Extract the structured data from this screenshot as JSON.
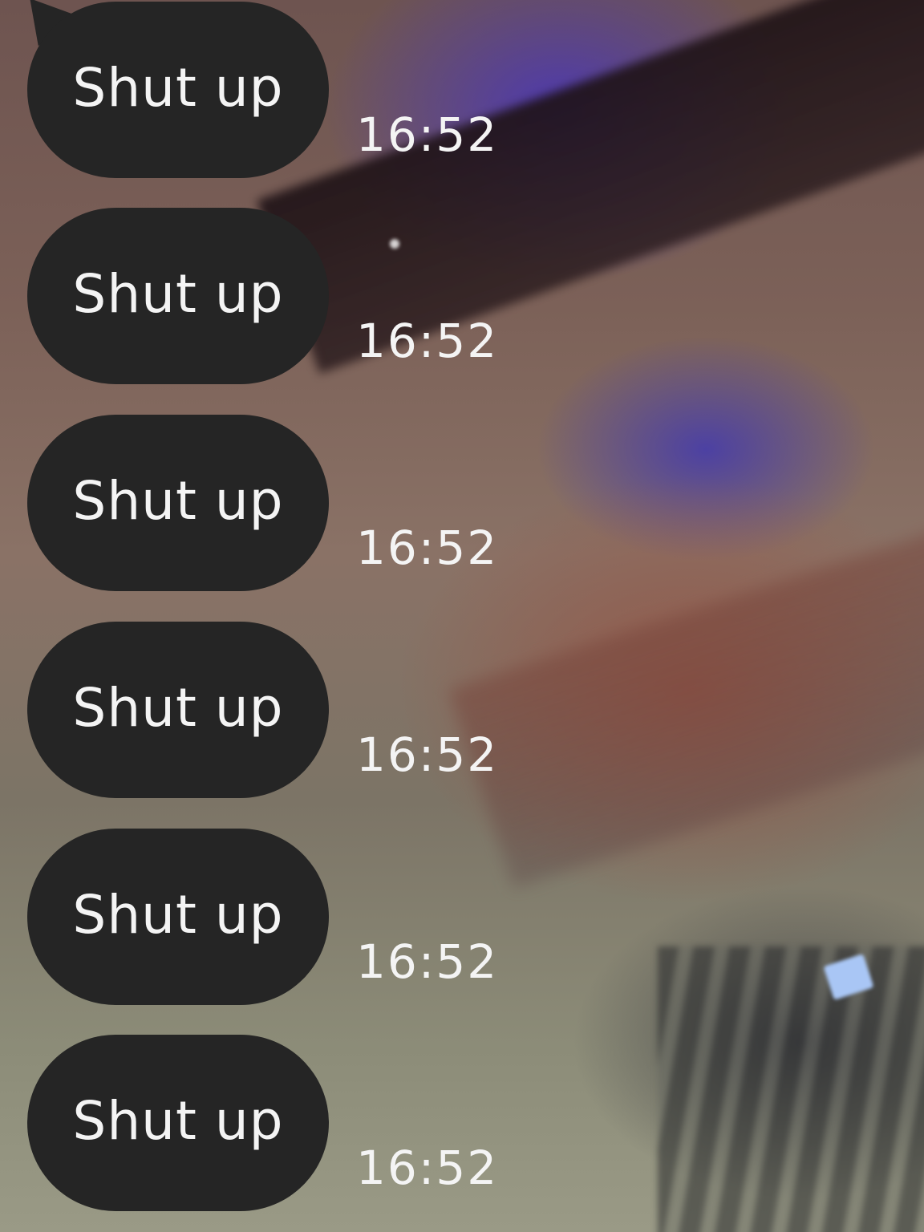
{
  "messages": [
    {
      "text": "Shut up",
      "time": "16:52"
    },
    {
      "text": "Shut up",
      "time": "16:52"
    },
    {
      "text": "Shut up",
      "time": "16:52"
    },
    {
      "text": "Shut up",
      "time": "16:52"
    },
    {
      "text": "Shut up",
      "time": "16:52"
    },
    {
      "text": "Shut up",
      "time": "16:52"
    }
  ],
  "colors": {
    "bubble": "#252525",
    "text": "#f4f4f4"
  }
}
